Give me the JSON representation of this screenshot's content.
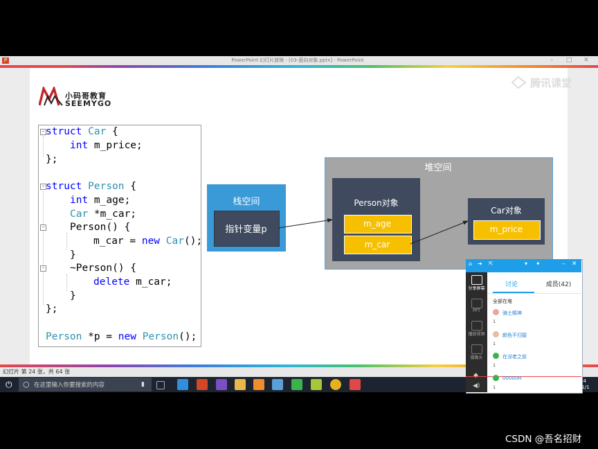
{
  "window": {
    "title": "PowerPoint 幻灯片放映 - [03-面向对象.pptx] - PowerPoint",
    "status": "幻灯片 第 24 张，共 64 张"
  },
  "logo": {
    "cn": "小码哥教育",
    "en": "SEEMYGO"
  },
  "code": [
    "struct Car {",
    "int m_price;",
    "};",
    "struct Person {",
    "int m_age;",
    "Car *m_car;",
    "Person() {",
    "m_car = new Car();",
    "}",
    "~Person() {",
    "delete m_car;",
    "}",
    "};",
    "Person *p = new Person();"
  ],
  "diagram": {
    "stack_title": "栈空间",
    "pointer_label": "指针变量p",
    "heap_title": "堆空间",
    "person_title": "Person对象",
    "m_age": "m_age",
    "m_car": "m_car",
    "car_title": "Car对象",
    "m_price": "m_price"
  },
  "colors": {
    "stack": "#3a9ad8",
    "heap": "#a5a5a5",
    "object": "#3f4a5e",
    "field": "#f6c000",
    "keyword": "#0000ff",
    "type": "#2b91af"
  },
  "watermark": "腾讯课堂",
  "taskbar": {
    "search_placeholder": "在这里输入你要搜索的内容",
    "time": "24",
    "date": "/1/1"
  },
  "classroom": {
    "sidebar": [
      "分享屏幕",
      "PPT",
      "播放视频",
      "摄像头"
    ],
    "tab_discuss": "讨论",
    "tab_members": "成员(42)",
    "all_label": "全部在堆",
    "messages": [
      {
        "name": "骑士精神",
        "text": "1"
      },
      {
        "name": "颜色不归猿",
        "text": "1"
      },
      {
        "name": "在没老之前",
        "text": "1"
      },
      {
        "name": "00000H",
        "text": "1"
      }
    ]
  },
  "csdn": "CSDN @吾名招财"
}
